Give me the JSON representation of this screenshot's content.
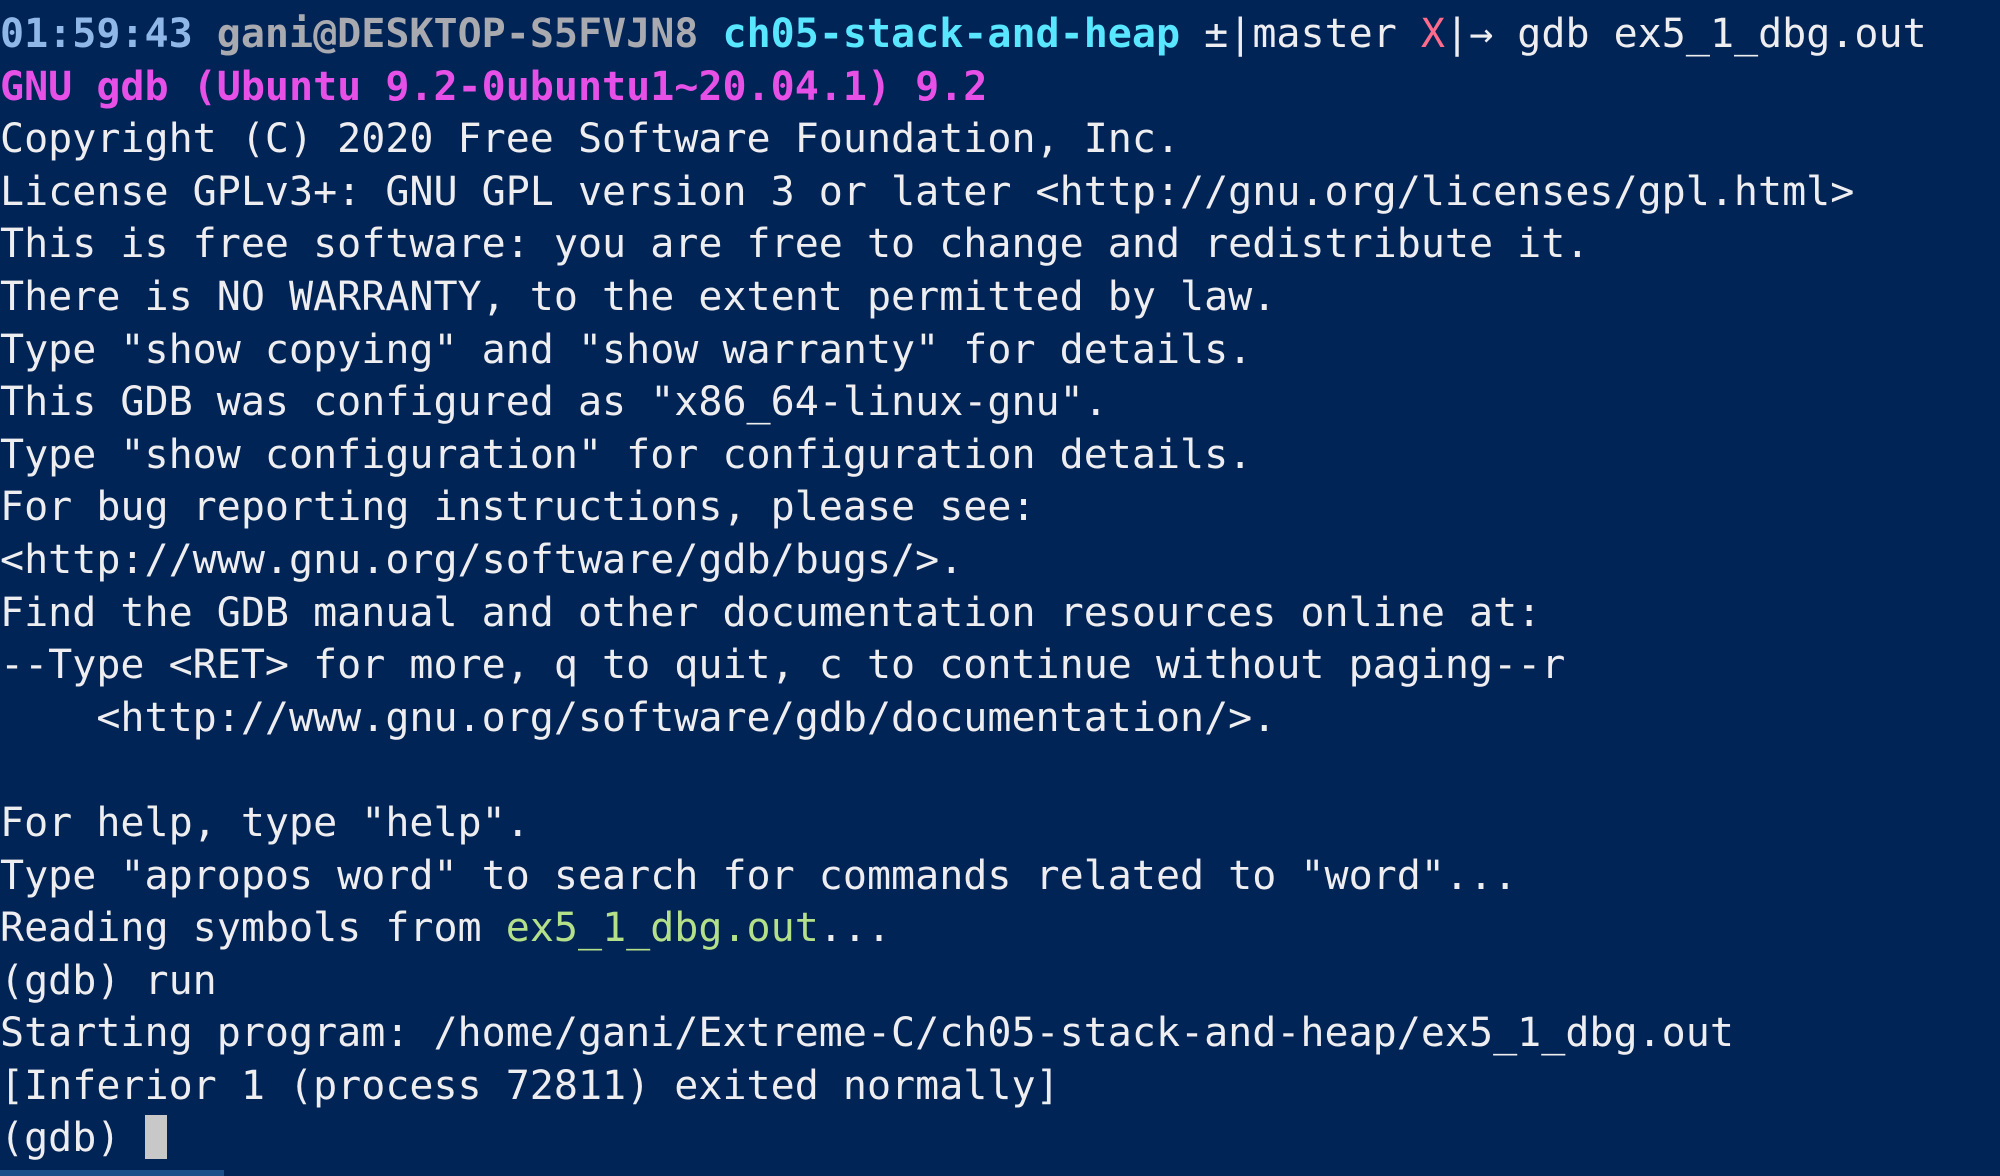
{
  "prompt": {
    "time": "01:59:43",
    "user_host": "gani@DESKTOP-S5FVJN8",
    "directory": "ch05-stack-and-heap",
    "git_marker": "±",
    "branch_sep": "|",
    "branch": "master",
    "dirty_mark": "X",
    "arrow": "|→",
    "command": "gdb ex5_1_dbg.out"
  },
  "output": {
    "banner": "GNU gdb (Ubuntu 9.2-0ubuntu1~20.04.1) 9.2",
    "lines": [
      "Copyright (C) 2020 Free Software Foundation, Inc.",
      "License GPLv3+: GNU GPL version 3 or later <http://gnu.org/licenses/gpl.html>",
      "This is free software: you are free to change and redistribute it.",
      "There is NO WARRANTY, to the extent permitted by law.",
      "Type \"show copying\" and \"show warranty\" for details.",
      "This GDB was configured as \"x86_64-linux-gnu\".",
      "Type \"show configuration\" for configuration details.",
      "For bug reporting instructions, please see:",
      "<http://www.gnu.org/software/gdb/bugs/>.",
      "Find the GDB manual and other documentation resources online at:",
      "--Type <RET> for more, q to quit, c to continue without paging--r",
      "    <http://www.gnu.org/software/gdb/documentation/>.",
      "",
      "For help, type \"help\".",
      "Type \"apropos word\" to search for commands related to \"word\"..."
    ],
    "reading_prefix": "Reading symbols from ",
    "reading_file": "ex5_1_dbg.out",
    "reading_suffix": "...",
    "run_prompt": "(gdb) run",
    "starting": "Starting program: /home/gani/Extreme-C/ch05-stack-and-heap/ex5_1_dbg.out",
    "exited": "[Inferior 1 (process 72811) exited normally]",
    "final_prompt": "(gdb) "
  },
  "colors": {
    "background": "#012456",
    "timestamp": "#8fb8e8",
    "directory": "#59e6ff",
    "banner": "#e650e6",
    "filename": "#b5e08a",
    "dirty": "#ff6b8a"
  }
}
